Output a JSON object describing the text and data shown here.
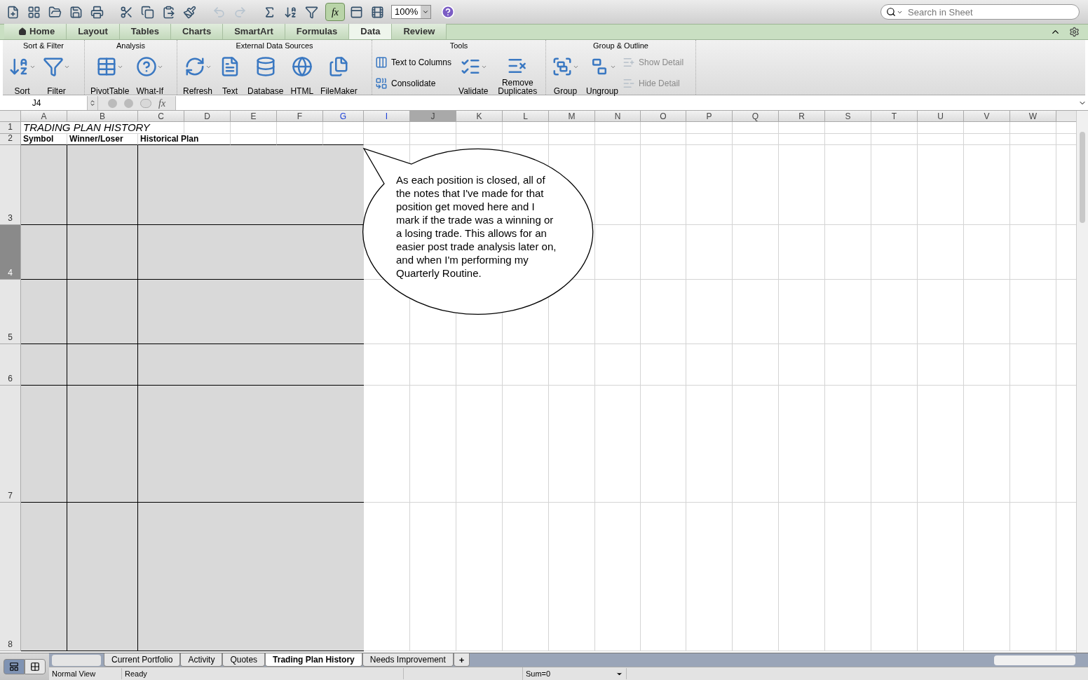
{
  "toolbar": {
    "zoom": "100%",
    "formula_builder_label": "fx",
    "formula_builder_on": true,
    "undo_disabled": true,
    "redo_disabled": true,
    "search": {
      "placeholder": "Search in Sheet"
    }
  },
  "ribbon_tabs": [
    {
      "label": "Home",
      "selected": false
    },
    {
      "label": "Layout",
      "selected": false
    },
    {
      "label": "Tables",
      "selected": false
    },
    {
      "label": "Charts",
      "selected": false
    },
    {
      "label": "SmartArt",
      "selected": false
    },
    {
      "label": "Formulas",
      "selected": false
    },
    {
      "label": "Data",
      "selected": true
    },
    {
      "label": "Review",
      "selected": false
    }
  ],
  "ribbon_groups": [
    {
      "title": "Sort & Filter",
      "items": [
        {
          "kind": "large",
          "label": "Sort",
          "dropdown": true,
          "disabled": false
        },
        {
          "kind": "large",
          "label": "Filter",
          "dropdown": true,
          "disabled": false
        }
      ]
    },
    {
      "title": "Analysis",
      "items": [
        {
          "kind": "large",
          "label": "PivotTable",
          "dropdown": true,
          "disabled": false
        },
        {
          "kind": "large",
          "label": "What-If",
          "dropdown": true,
          "disabled": false
        }
      ]
    },
    {
      "title": "External Data Sources",
      "items": [
        {
          "kind": "large",
          "label": "Refresh",
          "dropdown": true,
          "disabled": false
        },
        {
          "kind": "large",
          "label": "Text",
          "dropdown": false,
          "disabled": false
        },
        {
          "kind": "large",
          "label": "Database",
          "dropdown": false,
          "disabled": false
        },
        {
          "kind": "large",
          "label": "HTML",
          "dropdown": false,
          "disabled": false
        },
        {
          "kind": "large",
          "label": "FileMaker",
          "dropdown": false,
          "disabled": false
        }
      ]
    },
    {
      "title": "Tools",
      "items": [
        {
          "kind": "small",
          "label": "Text to Columns",
          "dropdown": false,
          "disabled": false
        },
        {
          "kind": "small",
          "label": "Consolidate",
          "dropdown": false,
          "disabled": false
        },
        {
          "kind": "large",
          "label": "Validate",
          "dropdown": true,
          "disabled": false
        },
        {
          "kind": "large",
          "label": "Remove Duplicates",
          "dropdown": false,
          "disabled": false
        }
      ]
    },
    {
      "title": "Group & Outline",
      "items": [
        {
          "kind": "large",
          "label": "Group",
          "dropdown": true,
          "disabled": false
        },
        {
          "kind": "large",
          "label": "Ungroup",
          "dropdown": true,
          "disabled": false
        },
        {
          "kind": "small",
          "label": "Show Detail",
          "dropdown": false,
          "disabled": true
        },
        {
          "kind": "small",
          "label": "Hide Detail",
          "dropdown": false,
          "disabled": true
        }
      ]
    }
  ],
  "formula_bar": {
    "name_box": "J4",
    "fx": "fx"
  },
  "columns": [
    {
      "label": "A",
      "selected": false,
      "marked": false
    },
    {
      "label": "B",
      "selected": false,
      "marked": false
    },
    {
      "label": "C",
      "selected": false,
      "marked": false
    },
    {
      "label": "D",
      "selected": false,
      "marked": false
    },
    {
      "label": "E",
      "selected": false,
      "marked": false
    },
    {
      "label": "F",
      "selected": false,
      "marked": false
    },
    {
      "label": "G",
      "selected": false,
      "marked": true
    },
    {
      "label": "I",
      "selected": false,
      "marked": true
    },
    {
      "label": "J",
      "selected": true,
      "marked": false
    },
    {
      "label": "K",
      "selected": false,
      "marked": false
    },
    {
      "label": "L",
      "selected": false,
      "marked": false
    },
    {
      "label": "M",
      "selected": false,
      "marked": false
    },
    {
      "label": "N",
      "selected": false,
      "marked": false
    },
    {
      "label": "O",
      "selected": false,
      "marked": false
    },
    {
      "label": "P",
      "selected": false,
      "marked": false
    },
    {
      "label": "Q",
      "selected": false,
      "marked": false
    },
    {
      "label": "R",
      "selected": false,
      "marked": false
    },
    {
      "label": "S",
      "selected": false,
      "marked": false
    },
    {
      "label": "T",
      "selected": false,
      "marked": false
    },
    {
      "label": "U",
      "selected": false,
      "marked": false
    },
    {
      "label": "V",
      "selected": false,
      "marked": false
    },
    {
      "label": "W",
      "selected": false,
      "marked": false
    }
  ],
  "rows": [
    {
      "number": "1",
      "selected": false,
      "cells": [
        {
          "kind": "title",
          "text": "TRADING PLAN HISTORY"
        }
      ]
    },
    {
      "number": "2",
      "selected": false,
      "cells": [
        {
          "kind": "header",
          "text": "Symbol"
        },
        {
          "kind": "header",
          "text": "Winner/Loser"
        },
        {
          "kind": "header",
          "text": "Historical Plan"
        }
      ]
    },
    {
      "number": "3",
      "selected": false,
      "cells": []
    },
    {
      "number": "4",
      "selected": true,
      "cells": []
    },
    {
      "number": "5",
      "selected": false,
      "cells": []
    },
    {
      "number": "6",
      "selected": false,
      "cells": []
    },
    {
      "number": "7",
      "selected": false,
      "cells": []
    },
    {
      "number": "8",
      "selected": false,
      "cells": []
    }
  ],
  "callout": {
    "text": "As each position is closed, all of the notes that I've made for that position get moved here and I mark if the trade was a winning or a losing trade.  This allows for an easier post trade analysis later on, and when I'm performing my Quarterly Routine."
  },
  "sheet_tabs": [
    {
      "label": "Current Portfolio",
      "selected": false
    },
    {
      "label": "Activity",
      "selected": false
    },
    {
      "label": "Quotes",
      "selected": false
    },
    {
      "label": "Trading Plan History",
      "selected": true
    },
    {
      "label": "Needs Improvement",
      "selected": false
    }
  ],
  "add_sheet": "+",
  "views": [
    {
      "selected": true
    },
    {
      "selected": false
    }
  ],
  "status_bar": {
    "view": "Normal View",
    "state": "Ready",
    "sum": "Sum=0"
  }
}
